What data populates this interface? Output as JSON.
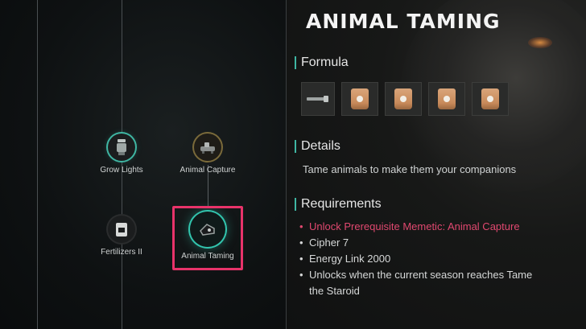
{
  "tree": {
    "nodes": [
      {
        "label": "Grow Lights"
      },
      {
        "label": "Animal Capture"
      },
      {
        "label": "Fertilizers II"
      },
      {
        "label": "Animal Taming"
      }
    ]
  },
  "detail": {
    "title": "ANIMAL TAMING",
    "formula_label": "Formula",
    "details_label": "Details",
    "details_text": "Tame animals to make them your companions",
    "requirements_label": "Requirements",
    "requirements": [
      "Unlock Prerequisite Memetic: Animal Capture",
      "Cipher 7",
      "Energy Link 2000",
      "Unlocks when the current season reaches Tame the Staroid"
    ]
  },
  "colors": {
    "accent_teal": "#3fb6a3",
    "highlight": "#e8336a",
    "requirement_unmet": "#e0486f"
  },
  "icons": {
    "formula_items": [
      "tool-rod-icon",
      "fertilizer-bag-icon",
      "fertilizer-bag-icon",
      "fertilizer-bag-icon",
      "fertilizer-bag-icon"
    ]
  }
}
